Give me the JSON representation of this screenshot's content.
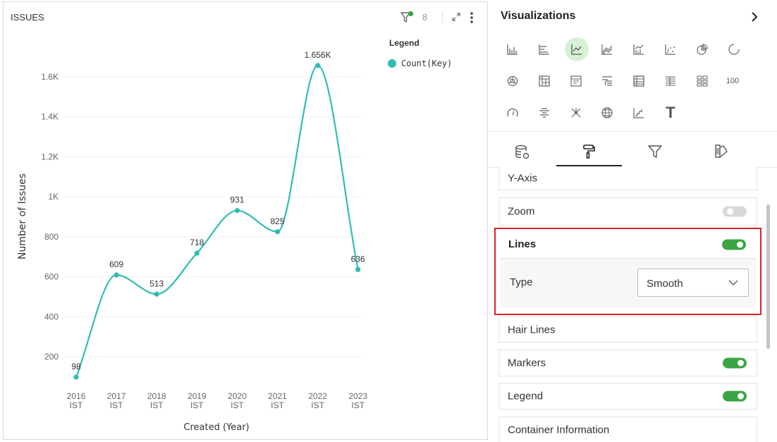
{
  "chart_panel": {
    "title": "ISSUES",
    "filter_count": "8",
    "legend_title": "Legend",
    "legend_label": "Count(Key)"
  },
  "chart_data": {
    "type": "line",
    "line_style": "smooth",
    "markers": true,
    "xlabel": "Created (Year)",
    "ylabel": "Number of Issues",
    "categories": [
      [
        "2016",
        "IST"
      ],
      [
        "2017",
        "IST"
      ],
      [
        "2018",
        "IST"
      ],
      [
        "2019",
        "IST"
      ],
      [
        "2020",
        "IST"
      ],
      [
        "2021",
        "IST"
      ],
      [
        "2022",
        "IST"
      ],
      [
        "2023",
        "IST"
      ]
    ],
    "series": [
      {
        "name": "Count(Key)",
        "color": "#2fbdb0",
        "values": [
          98,
          609,
          513,
          718,
          931,
          825,
          1656,
          636
        ],
        "labels": [
          "98",
          "609",
          "513",
          "718",
          "931",
          "825",
          "1.656K",
          "636"
        ]
      }
    ],
    "y_ticks": [
      200,
      400,
      600,
      800,
      1000,
      1200,
      1400,
      1600
    ],
    "y_tick_labels": [
      "200",
      "400",
      "600",
      "800",
      "1K",
      "1.2K",
      "1.4K",
      "1.6K"
    ],
    "ylim": [
      0,
      1700
    ],
    "grid": true,
    "legend_position": "top-right"
  },
  "viz_panel": {
    "title": "Visualizations",
    "viz_icons_row1": [
      "bar-chart",
      "horizontal-bar",
      "line-chart",
      "area-chart",
      "combo-chart",
      "scatter-chart",
      "pie-chart",
      "donut-chart"
    ],
    "viz_icons_row2": [
      "radar-chart",
      "pivot-table",
      "table-detail",
      "funnel",
      "table",
      "list-table",
      "tile-grid",
      "kpi-number"
    ],
    "viz_icons_row3": [
      "gauge",
      "tree-grid",
      "network",
      "globe-map",
      "step-chart",
      "text"
    ],
    "kpi_text": "100",
    "text_viz_glyph": "T",
    "tabs": [
      "data-tab",
      "format-tab",
      "filter-tab",
      "theme-tab"
    ],
    "sections": {
      "y_axis": "Y-Axis",
      "zoom": "Zoom",
      "lines": "Lines",
      "type_label": "Type",
      "type_value": "Smooth",
      "hair_lines": "Hair Lines",
      "markers": "Markers",
      "legend": "Legend",
      "container_info": "Container Information"
    },
    "toggles": {
      "zoom": false,
      "lines": true,
      "markers": true,
      "legend": true
    }
  },
  "colors": {
    "accent_line": "#2fbdb0",
    "toggle_on": "#3aa542",
    "highlight_border": "#dd1f25",
    "selected_viz_bg": "#d6f0d4"
  }
}
